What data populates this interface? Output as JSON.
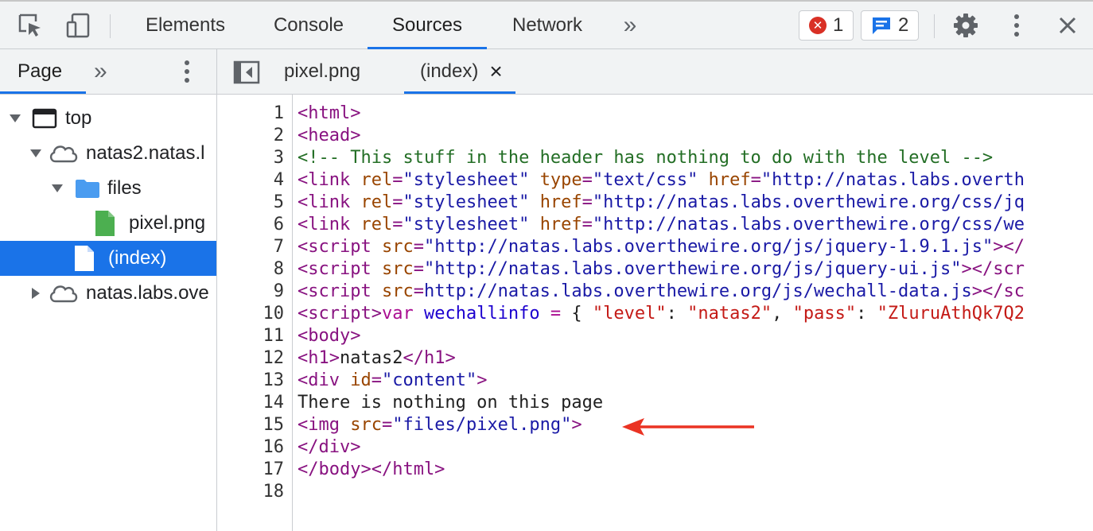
{
  "toolbar": {
    "tabs": [
      {
        "label": "Elements"
      },
      {
        "label": "Console"
      },
      {
        "label": "Sources"
      },
      {
        "label": "Network"
      }
    ],
    "more_label": "»",
    "errors_count": "1",
    "messages_count": "2"
  },
  "navigator": {
    "tab_label": "Page",
    "more_label": "»",
    "tree": [
      {
        "label": "top"
      },
      {
        "label": "natas2.natas.l"
      },
      {
        "label": "files"
      },
      {
        "label": "pixel.png"
      },
      {
        "label": "(index)"
      },
      {
        "label": "natas.labs.ove"
      }
    ]
  },
  "editor": {
    "file_tabs": [
      {
        "label": "pixel.png"
      },
      {
        "label": "(index)"
      }
    ],
    "close_glyph": "×",
    "line_numbers": [
      "1",
      "2",
      "3",
      "4",
      "5",
      "6",
      "7",
      "8",
      "9",
      "10",
      "11",
      "12",
      "13",
      "14",
      "15",
      "16",
      "17",
      "18"
    ],
    "lines": [
      [
        {
          "c": "tg",
          "t": "<html>"
        }
      ],
      [
        {
          "c": "tg",
          "t": "<head>"
        }
      ],
      [
        {
          "c": "cm",
          "t": "<!-- This stuff in the header has nothing to do with the level -->"
        }
      ],
      [
        {
          "c": "tg",
          "t": "<link "
        },
        {
          "c": "at",
          "t": "rel"
        },
        {
          "c": "tg",
          "t": "="
        },
        {
          "c": "av",
          "t": "\"stylesheet\""
        },
        {
          "c": "tg",
          "t": " "
        },
        {
          "c": "at",
          "t": "type"
        },
        {
          "c": "tg",
          "t": "="
        },
        {
          "c": "av",
          "t": "\"text/css\""
        },
        {
          "c": "tg",
          "t": " "
        },
        {
          "c": "at",
          "t": "href"
        },
        {
          "c": "tg",
          "t": "="
        },
        {
          "c": "av",
          "t": "\"http://natas.labs.overth"
        }
      ],
      [
        {
          "c": "tg",
          "t": "<link "
        },
        {
          "c": "at",
          "t": "rel"
        },
        {
          "c": "tg",
          "t": "="
        },
        {
          "c": "av",
          "t": "\"stylesheet\""
        },
        {
          "c": "tg",
          "t": " "
        },
        {
          "c": "at",
          "t": "href"
        },
        {
          "c": "tg",
          "t": "="
        },
        {
          "c": "av",
          "t": "\"http://natas.labs.overthewire.org/css/jq"
        }
      ],
      [
        {
          "c": "tg",
          "t": "<link "
        },
        {
          "c": "at",
          "t": "rel"
        },
        {
          "c": "tg",
          "t": "="
        },
        {
          "c": "av",
          "t": "\"stylesheet\""
        },
        {
          "c": "tg",
          "t": " "
        },
        {
          "c": "at",
          "t": "href"
        },
        {
          "c": "tg",
          "t": "="
        },
        {
          "c": "av",
          "t": "\"http://natas.labs.overthewire.org/css/we"
        }
      ],
      [
        {
          "c": "tg",
          "t": "<script "
        },
        {
          "c": "at",
          "t": "src"
        },
        {
          "c": "tg",
          "t": "="
        },
        {
          "c": "av",
          "t": "\"http://natas.labs.overthewire.org/js/jquery-1.9.1.js\""
        },
        {
          "c": "tg",
          "t": "></"
        }
      ],
      [
        {
          "c": "tg",
          "t": "<script "
        },
        {
          "c": "at",
          "t": "src"
        },
        {
          "c": "tg",
          "t": "="
        },
        {
          "c": "av",
          "t": "\"http://natas.labs.overthewire.org/js/jquery-ui.js\""
        },
        {
          "c": "tg",
          "t": "></scr"
        }
      ],
      [
        {
          "c": "tg",
          "t": "<script "
        },
        {
          "c": "at",
          "t": "src"
        },
        {
          "c": "tg",
          "t": "="
        },
        {
          "c": "av",
          "t": "http://natas.labs.overthewire.org/js/wechall-data.js"
        },
        {
          "c": "tg",
          "t": "></sc"
        }
      ],
      [
        {
          "c": "tg",
          "t": "<script>"
        },
        {
          "c": "kw",
          "t": "var"
        },
        {
          "c": "tx",
          "t": " "
        },
        {
          "c": "vr",
          "t": "wechallinfo"
        },
        {
          "c": "tx",
          "t": " "
        },
        {
          "c": "kw",
          "t": "="
        },
        {
          "c": "tx",
          "t": " { "
        },
        {
          "c": "st",
          "t": "\"level\""
        },
        {
          "c": "tx",
          "t": ": "
        },
        {
          "c": "st",
          "t": "\"natas2\""
        },
        {
          "c": "tx",
          "t": ", "
        },
        {
          "c": "st",
          "t": "\"pass\""
        },
        {
          "c": "tx",
          "t": ": "
        },
        {
          "c": "st",
          "t": "\"ZluruAthQk7Q2"
        }
      ],
      [
        {
          "c": "tg",
          "t": "<body>"
        }
      ],
      [
        {
          "c": "tg",
          "t": "<h1>"
        },
        {
          "c": "tx",
          "t": "natas2"
        },
        {
          "c": "tg",
          "t": "</h1>"
        }
      ],
      [
        {
          "c": "tg",
          "t": "<div "
        },
        {
          "c": "at",
          "t": "id"
        },
        {
          "c": "tg",
          "t": "="
        },
        {
          "c": "av",
          "t": "\"content\""
        },
        {
          "c": "tg",
          "t": ">"
        }
      ],
      [
        {
          "c": "tx",
          "t": "There is nothing on this page"
        }
      ],
      [
        {
          "c": "tg",
          "t": "<img "
        },
        {
          "c": "at",
          "t": "src"
        },
        {
          "c": "tg",
          "t": "="
        },
        {
          "c": "av",
          "t": "\"files/pixel.png\""
        },
        {
          "c": "tg",
          "t": ">"
        }
      ],
      [
        {
          "c": "tg",
          "t": "</div>"
        }
      ],
      [
        {
          "c": "tg",
          "t": "</body></html>"
        }
      ],
      []
    ]
  },
  "colors": {
    "accent": "#1a73e8",
    "error": "#d93025",
    "annotation_arrow": "#ea3323"
  }
}
